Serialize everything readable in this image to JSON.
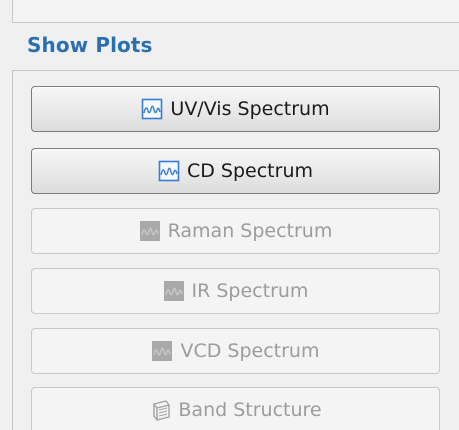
{
  "section": {
    "title": "Show Plots"
  },
  "buttons": [
    {
      "label": "UV/Vis Spectrum",
      "icon": "spectrum-icon",
      "enabled": true
    },
    {
      "label": "CD Spectrum",
      "icon": "spectrum-icon",
      "enabled": true
    },
    {
      "label": "Raman Spectrum",
      "icon": "spectrum-icon",
      "enabled": false
    },
    {
      "label": "IR Spectrum",
      "icon": "spectrum-icon",
      "enabled": false
    },
    {
      "label": "VCD Spectrum",
      "icon": "spectrum-icon",
      "enabled": false
    },
    {
      "label": "Band Structure",
      "icon": "band-structure-icon",
      "enabled": false
    }
  ],
  "colors": {
    "header_blue": "#2b6fb3",
    "icon_blue": "#3a7bd5",
    "disabled_text": "#9c9c9c"
  }
}
